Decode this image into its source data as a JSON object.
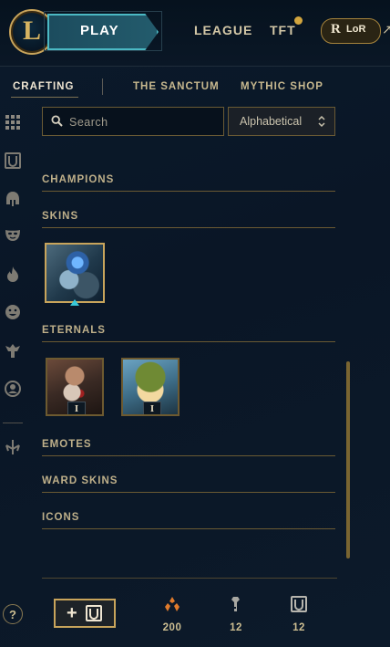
{
  "header": {
    "play_label": "PLAY",
    "nav": [
      {
        "label": "LEAGUE"
      },
      {
        "label": "TFT",
        "has_notification": true
      }
    ],
    "lor_badge": {
      "letter": "R",
      "label": "LoR"
    },
    "external_arrow": "↗"
  },
  "subnav": {
    "tabs": [
      {
        "label": "CRAFTING",
        "active": true
      },
      {
        "label": "THE SANCTUM",
        "active": false
      },
      {
        "label": "MYTHIC SHOP",
        "active": false
      }
    ]
  },
  "sidebar": {
    "icons": [
      "grid-icon",
      "chest-icon",
      "helmet-icon",
      "mask-icon",
      "flame-icon",
      "emote-icon",
      "ward-icon",
      "profile-icon",
      "hextech-icon"
    ]
  },
  "toolbar": {
    "search_placeholder": "Search",
    "sort_selected": "Alphabetical"
  },
  "sections": [
    {
      "title": "CHAMPIONS",
      "items": []
    },
    {
      "title": "SKINS",
      "items": [
        {
          "kind": "skin",
          "selected": true
        }
      ]
    },
    {
      "title": "ETERNALS",
      "items": [
        {
          "kind": "eternal",
          "series": "I"
        },
        {
          "kind": "eternal",
          "series": "I"
        }
      ]
    },
    {
      "title": "EMOTES",
      "items": []
    },
    {
      "title": "WARD SKINS",
      "items": []
    },
    {
      "title": "ICONS",
      "items": []
    }
  ],
  "footer": {
    "help_label": "?",
    "add_button_label": "+",
    "currencies": [
      {
        "icon": "orange-essence-icon",
        "value": "200",
        "color": "#e07b2c"
      },
      {
        "icon": "key-fragment-icon",
        "value": "12",
        "color": "#a9a8a2"
      },
      {
        "icon": "chest-icon",
        "value": "12",
        "color": "#b7b5ae"
      }
    ]
  },
  "colors": {
    "accent_gold": "#c8a45b",
    "play_teal": "#4bb9c4",
    "notification": "#d2a53e",
    "background": "#0a1626"
  }
}
